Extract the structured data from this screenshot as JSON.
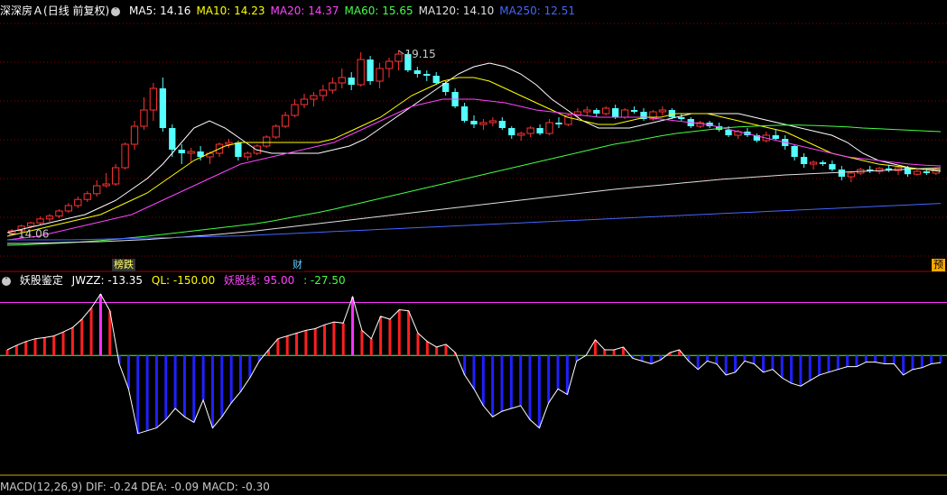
{
  "main_header": {
    "stock_name": "深深房Ａ",
    "mode": "(日线 前复权)",
    "ma": [
      {
        "label": "MA5: 14.16",
        "color": "#ffffff"
      },
      {
        "label": "MA10: 14.23",
        "color": "#ffff00"
      },
      {
        "label": "MA20: 14.37",
        "color": "#ff44ff"
      },
      {
        "label": "MA60: 15.65",
        "color": "#44ff44"
      },
      {
        "label": "MA120: 14.10",
        "color": "#e0e0e0"
      },
      {
        "label": "MA250: 12.51",
        "color": "#4466ff"
      }
    ]
  },
  "main_annotations": {
    "high_label": "19.15",
    "low_label": "14.06"
  },
  "event_tags": [
    {
      "text": "榜跌",
      "color": "#ffff66",
      "bg": "#333333"
    },
    {
      "text": "财",
      "color": "#66ccff",
      "bg": "#000000"
    },
    {
      "text": "预",
      "color": "#000000",
      "bg": "#ffaa00"
    }
  ],
  "indicator_header": {
    "name": "妖股鉴定",
    "jwzz": "JWZZ: -13.35",
    "ql": "QL: -150.00",
    "yaogu": "妖股线: 95.00",
    "last": ": -27.50"
  },
  "bottom_header": {
    "text": "MACD(12,26,9) DIF: -0.24 DEA: -0.09 MACD: -0.30"
  },
  "colors": {
    "up": "#ff3232",
    "down": "#54ffff",
    "grid": "#8b0000",
    "ind_pos": "#ff2020",
    "ind_neg": "#2020ff",
    "ind_hot": "#ff33ff",
    "ma5": "#ffffff",
    "ma10": "#ffff00",
    "ma20": "#ff44ff",
    "ma60": "#44ff44",
    "ma120": "#e0e0e0",
    "ma250": "#4466ff"
  },
  "chart_data": [
    {
      "type": "candlestick",
      "title": "深深房Ａ (日线 前复权)",
      "ylim": [
        13.5,
        20.0
      ],
      "candles": [
        [
          14.08,
          14.2,
          14.04,
          14.15
        ],
        [
          14.15,
          14.32,
          14.1,
          14.28
        ],
        [
          14.28,
          14.4,
          14.22,
          14.37
        ],
        [
          14.37,
          14.55,
          14.3,
          14.48
        ],
        [
          14.48,
          14.62,
          14.4,
          14.56
        ],
        [
          14.56,
          14.75,
          14.5,
          14.7
        ],
        [
          14.7,
          14.92,
          14.65,
          14.85
        ],
        [
          14.85,
          15.1,
          14.78,
          15.02
        ],
        [
          15.02,
          15.25,
          14.95,
          15.18
        ],
        [
          15.18,
          15.55,
          15.1,
          15.4
        ],
        [
          15.4,
          15.75,
          15.35,
          15.45
        ],
        [
          15.45,
          16.0,
          15.4,
          15.9
        ],
        [
          15.9,
          16.6,
          15.85,
          16.55
        ],
        [
          16.55,
          17.2,
          16.4,
          17.05
        ],
        [
          17.05,
          17.85,
          16.95,
          17.5
        ],
        [
          17.5,
          18.25,
          17.2,
          18.1
        ],
        [
          18.1,
          18.4,
          16.9,
          17.0
        ],
        [
          17.0,
          17.1,
          16.2,
          16.4
        ],
        [
          16.4,
          16.55,
          16.0,
          16.3
        ],
        [
          16.3,
          16.45,
          16.05,
          16.35
        ],
        [
          16.35,
          16.5,
          16.1,
          16.2
        ],
        [
          16.2,
          16.35,
          16.0,
          16.3
        ],
        [
          16.3,
          16.6,
          16.2,
          16.55
        ],
        [
          16.55,
          16.7,
          16.45,
          16.6
        ],
        [
          16.6,
          16.65,
          16.1,
          16.2
        ],
        [
          16.2,
          16.35,
          16.1,
          16.3
        ],
        [
          16.3,
          16.55,
          16.25,
          16.5
        ],
        [
          16.5,
          16.8,
          16.45,
          16.75
        ],
        [
          16.75,
          17.1,
          16.7,
          17.05
        ],
        [
          17.05,
          17.45,
          17.0,
          17.35
        ],
        [
          17.35,
          17.8,
          17.3,
          17.65
        ],
        [
          17.65,
          17.95,
          17.55,
          17.8
        ],
        [
          17.8,
          18.0,
          17.6,
          17.9
        ],
        [
          17.9,
          18.2,
          17.75,
          18.05
        ],
        [
          18.05,
          18.4,
          17.95,
          18.25
        ],
        [
          18.25,
          18.65,
          18.1,
          18.4
        ],
        [
          18.4,
          18.55,
          18.05,
          18.2
        ],
        [
          18.2,
          19.1,
          18.15,
          18.9
        ],
        [
          18.9,
          19.0,
          18.2,
          18.3
        ],
        [
          18.3,
          18.8,
          18.1,
          18.65
        ],
        [
          18.65,
          18.95,
          18.4,
          18.85
        ],
        [
          18.85,
          19.15,
          18.6,
          19.05
        ],
        [
          19.05,
          19.1,
          18.55,
          18.6
        ],
        [
          18.6,
          18.7,
          18.4,
          18.5
        ],
        [
          18.5,
          18.6,
          18.3,
          18.45
        ],
        [
          18.45,
          18.55,
          18.2,
          18.25
        ],
        [
          18.25,
          18.3,
          17.9,
          18.0
        ],
        [
          18.0,
          18.1,
          17.55,
          17.6
        ],
        [
          17.6,
          17.7,
          17.15,
          17.2
        ],
        [
          17.2,
          17.35,
          17.0,
          17.1
        ],
        [
          17.1,
          17.25,
          16.95,
          17.15
        ],
        [
          17.15,
          17.3,
          17.05,
          17.2
        ],
        [
          17.2,
          17.3,
          16.95,
          17.0
        ],
        [
          17.0,
          17.05,
          16.7,
          16.8
        ],
        [
          16.8,
          16.9,
          16.65,
          16.85
        ],
        [
          16.85,
          17.05,
          16.75,
          17.0
        ],
        [
          17.0,
          17.1,
          16.8,
          16.85
        ],
        [
          16.85,
          17.25,
          16.8,
          17.15
        ],
        [
          17.15,
          17.3,
          17.0,
          17.1
        ],
        [
          17.1,
          17.4,
          17.05,
          17.35
        ],
        [
          17.35,
          17.55,
          17.25,
          17.45
        ],
        [
          17.45,
          17.6,
          17.35,
          17.5
        ],
        [
          17.5,
          17.55,
          17.3,
          17.4
        ],
        [
          17.4,
          17.6,
          17.35,
          17.55
        ],
        [
          17.55,
          17.65,
          17.25,
          17.3
        ],
        [
          17.3,
          17.55,
          17.25,
          17.5
        ],
        [
          17.5,
          17.6,
          17.4,
          17.45
        ],
        [
          17.45,
          17.55,
          17.2,
          17.25
        ],
        [
          17.25,
          17.5,
          17.2,
          17.45
        ],
        [
          17.45,
          17.6,
          17.35,
          17.5
        ],
        [
          17.5,
          17.55,
          17.25,
          17.3
        ],
        [
          17.3,
          17.4,
          17.2,
          17.25
        ],
        [
          17.25,
          17.3,
          17.0,
          17.05
        ],
        [
          17.05,
          17.2,
          17.0,
          17.15
        ],
        [
          17.15,
          17.2,
          17.0,
          17.05
        ],
        [
          17.05,
          17.15,
          16.9,
          16.95
        ],
        [
          16.95,
          17.05,
          16.75,
          16.8
        ],
        [
          16.8,
          16.95,
          16.7,
          16.9
        ],
        [
          16.9,
          17.0,
          16.75,
          16.8
        ],
        [
          16.8,
          16.85,
          16.6,
          16.65
        ],
        [
          16.65,
          16.9,
          16.6,
          16.8
        ],
        [
          16.8,
          16.95,
          16.65,
          16.7
        ],
        [
          16.7,
          16.8,
          16.4,
          16.5
        ],
        [
          16.5,
          16.55,
          16.1,
          16.2
        ],
        [
          16.2,
          16.3,
          15.9,
          16.0
        ],
        [
          16.0,
          16.1,
          15.85,
          16.05
        ],
        [
          16.05,
          16.1,
          15.95,
          16.0
        ],
        [
          16.0,
          16.1,
          15.8,
          15.85
        ],
        [
          15.85,
          15.95,
          15.55,
          15.65
        ],
        [
          15.65,
          15.8,
          15.5,
          15.75
        ],
        [
          15.75,
          15.9,
          15.7,
          15.85
        ],
        [
          15.85,
          15.95,
          15.75,
          15.8
        ],
        [
          15.8,
          15.92,
          15.72,
          15.88
        ],
        [
          15.88,
          15.98,
          15.78,
          15.82
        ],
        [
          15.82,
          15.95,
          15.7,
          15.9
        ],
        [
          15.9,
          15.95,
          15.65,
          15.72
        ],
        [
          15.72,
          15.85,
          15.68,
          15.8
        ],
        [
          15.8,
          15.88,
          15.7,
          15.75
        ],
        [
          15.75,
          15.9,
          15.7,
          15.86
        ]
      ],
      "ma_lines": {
        "MA5": [
          14.1,
          14.2,
          14.3,
          14.4,
          14.5,
          14.6,
          14.8,
          15.0,
          15.3,
          15.6,
          16.0,
          16.5,
          17.0,
          17.2,
          17.0,
          16.7,
          16.4,
          16.3,
          16.3,
          16.3,
          16.3,
          16.4,
          16.5,
          16.7,
          17.0,
          17.3,
          17.6,
          17.9,
          18.2,
          18.5,
          18.7,
          18.8,
          18.7,
          18.5,
          18.2,
          17.8,
          17.5,
          17.2,
          17.0,
          17.0,
          17.0,
          17.1,
          17.2,
          17.3,
          17.4,
          17.4,
          17.4,
          17.4,
          17.3,
          17.2,
          17.1,
          17.0,
          16.9,
          16.8,
          16.6,
          16.3,
          16.1,
          16.0,
          15.9,
          15.85,
          15.8
        ],
        "MA10": [
          14.0,
          14.1,
          14.2,
          14.3,
          14.4,
          14.5,
          14.6,
          14.8,
          15.0,
          15.2,
          15.5,
          15.8,
          16.1,
          16.3,
          16.5,
          16.6,
          16.6,
          16.6,
          16.6,
          16.6,
          16.6,
          16.7,
          16.9,
          17.1,
          17.3,
          17.6,
          17.9,
          18.1,
          18.3,
          18.4,
          18.4,
          18.3,
          18.1,
          17.9,
          17.7,
          17.5,
          17.3,
          17.2,
          17.1,
          17.1,
          17.2,
          17.3,
          17.3,
          17.4,
          17.4,
          17.4,
          17.3,
          17.2,
          17.1,
          17.0,
          16.9,
          16.7,
          16.5,
          16.3,
          16.2,
          16.1,
          16.0,
          15.95,
          15.9,
          15.85,
          15.85
        ],
        "MA20": [
          13.9,
          13.95,
          14.0,
          14.1,
          14.2,
          14.3,
          14.4,
          14.5,
          14.6,
          14.8,
          15.0,
          15.2,
          15.4,
          15.6,
          15.8,
          16.0,
          16.1,
          16.2,
          16.3,
          16.4,
          16.5,
          16.6,
          16.8,
          17.0,
          17.2,
          17.4,
          17.6,
          17.7,
          17.8,
          17.8,
          17.8,
          17.75,
          17.7,
          17.6,
          17.5,
          17.45,
          17.4,
          17.35,
          17.3,
          17.3,
          17.3,
          17.3,
          17.25,
          17.2,
          17.15,
          17.1,
          17.0,
          16.9,
          16.8,
          16.7,
          16.6,
          16.5,
          16.4,
          16.3,
          16.2,
          16.15,
          16.1,
          16.05,
          16.0,
          15.97,
          15.95
        ],
        "MA60": [
          13.75,
          13.76,
          13.78,
          13.8,
          13.82,
          13.85,
          13.88,
          13.92,
          13.96,
          14.0,
          14.05,
          14.1,
          14.15,
          14.2,
          14.25,
          14.3,
          14.35,
          14.42,
          14.5,
          14.58,
          14.66,
          14.75,
          14.85,
          14.95,
          15.05,
          15.15,
          15.25,
          15.35,
          15.45,
          15.55,
          15.65,
          15.75,
          15.85,
          15.95,
          16.05,
          16.15,
          16.25,
          16.35,
          16.45,
          16.55,
          16.62,
          16.7,
          16.78,
          16.85,
          16.9,
          16.95,
          17.0,
          17.03,
          17.05,
          17.07,
          17.08,
          17.08,
          17.07,
          17.05,
          17.03,
          17.0,
          16.98,
          16.96,
          16.94,
          16.92,
          16.9
        ],
        "MA120": [
          13.8,
          13.8,
          13.81,
          13.82,
          13.83,
          13.84,
          13.85,
          13.87,
          13.89,
          13.91,
          13.94,
          13.97,
          14.0,
          14.03,
          14.07,
          14.11,
          14.15,
          14.2,
          14.25,
          14.3,
          14.35,
          14.4,
          14.45,
          14.5,
          14.55,
          14.6,
          14.65,
          14.7,
          14.75,
          14.8,
          14.85,
          14.9,
          14.95,
          15.0,
          15.05,
          15.1,
          15.15,
          15.2,
          15.25,
          15.3,
          15.34,
          15.38,
          15.42,
          15.46,
          15.5,
          15.54,
          15.58,
          15.61,
          15.64,
          15.67,
          15.7,
          15.72,
          15.74,
          15.76,
          15.78,
          15.8,
          15.82,
          15.84,
          15.86,
          15.88,
          15.9
        ],
        "MA250": [
          13.9,
          13.9,
          13.9,
          13.9,
          13.9,
          13.91,
          13.92,
          13.93,
          13.94,
          13.95,
          13.96,
          13.97,
          13.98,
          13.99,
          14.0,
          14.01,
          14.03,
          14.05,
          14.07,
          14.09,
          14.11,
          14.13,
          14.15,
          14.17,
          14.19,
          14.21,
          14.23,
          14.25,
          14.27,
          14.29,
          14.31,
          14.33,
          14.35,
          14.37,
          14.39,
          14.41,
          14.43,
          14.45,
          14.47,
          14.49,
          14.51,
          14.53,
          14.55,
          14.57,
          14.59,
          14.61,
          14.63,
          14.65,
          14.67,
          14.69,
          14.71,
          14.73,
          14.75,
          14.77,
          14.79,
          14.81,
          14.83,
          14.85,
          14.87,
          14.89,
          14.91
        ]
      }
    },
    {
      "type": "bar",
      "title": "妖股鉴定",
      "ylim": [
        -150,
        120
      ],
      "reference_lines": [
        95,
        0
      ],
      "values": [
        10,
        18,
        25,
        30,
        32,
        35,
        42,
        50,
        65,
        85,
        110,
        80,
        -15,
        -60,
        -140,
        -135,
        -130,
        -115,
        -95,
        -110,
        -120,
        -80,
        -130,
        -110,
        -85,
        -65,
        -40,
        -10,
        10,
        30,
        35,
        40,
        45,
        48,
        55,
        60,
        58,
        105,
        45,
        30,
        70,
        65,
        82,
        80,
        40,
        25,
        15,
        20,
        5,
        -35,
        -60,
        -90,
        -110,
        -100,
        -95,
        -90,
        -115,
        -130,
        -85,
        -60,
        -70,
        -10,
        0,
        28,
        10,
        10,
        15,
        -5,
        -10,
        -15,
        -8,
        5,
        10,
        -10,
        -25,
        -10,
        -15,
        -35,
        -30,
        -10,
        -15,
        -30,
        -25,
        -40,
        -50,
        -55,
        -45,
        -35,
        -30,
        -25,
        -20,
        -20,
        -12,
        -12,
        -15,
        -15,
        -35,
        -25,
        -22,
        -15,
        -13
      ]
    }
  ]
}
